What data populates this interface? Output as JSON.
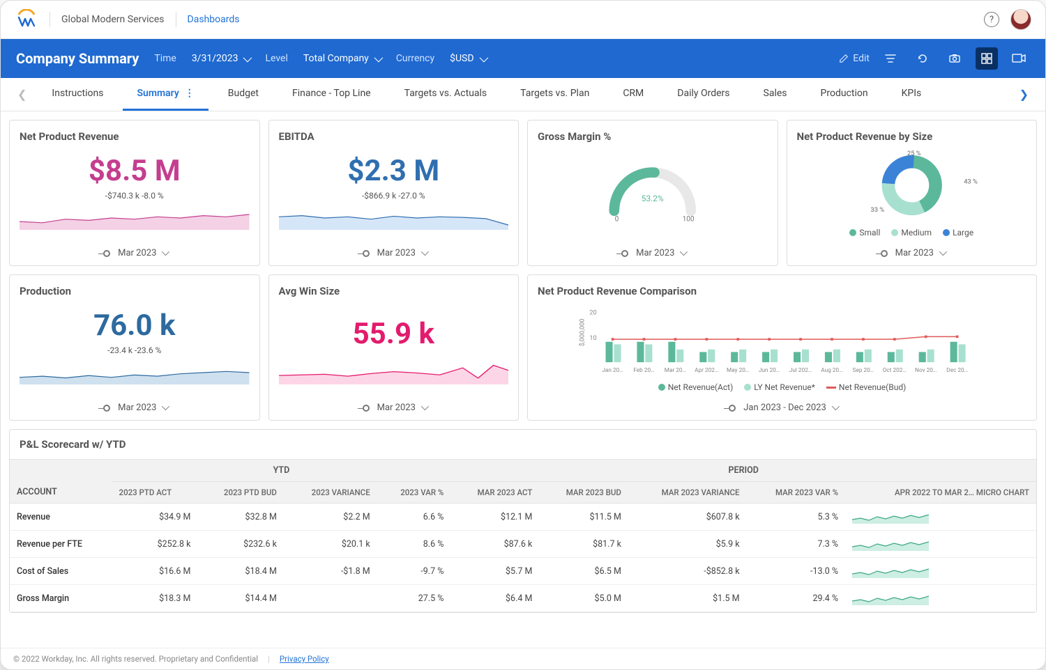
{
  "header": {
    "org": "Global Modern Services",
    "crumb": "Dashboards"
  },
  "bluebar": {
    "title": "Company Summary",
    "filters": [
      {
        "label": "Time",
        "value": "3/31/2023"
      },
      {
        "label": "Level",
        "value": "Total Company"
      },
      {
        "label": "Currency",
        "value": "$USD"
      }
    ],
    "edit": "Edit"
  },
  "tabs": [
    "Instructions",
    "Summary",
    "Budget",
    "Finance - Top Line",
    "Targets vs. Actuals",
    "Targets vs. Plan",
    "CRM",
    "Daily Orders",
    "Sales",
    "Production",
    "KPIs"
  ],
  "active_tab": 1,
  "cards": {
    "net_rev": {
      "title": "Net Product Revenue",
      "value": "$8.5 M",
      "delta": "-$740.3 k   -8.0 %",
      "footer": "Mar 2023"
    },
    "ebitda": {
      "title": "EBITDA",
      "value": "$2.3 M",
      "delta": "-$866.9 k   -27.0 %",
      "footer": "Mar 2023"
    },
    "gross": {
      "title": "Gross Margin %",
      "value": "53.2%",
      "min": "0",
      "max": "100",
      "footer": "Mar 2023"
    },
    "by_size": {
      "title": "Net Product Revenue by Size",
      "footer": "Mar 2023",
      "slices": [
        {
          "label": "Small",
          "pct": 43
        },
        {
          "label": "Medium",
          "pct": 33
        },
        {
          "label": "Large",
          "pct": 25
        }
      ],
      "callouts": [
        "25 %",
        "43 %",
        "33 %"
      ]
    },
    "production": {
      "title": "Production",
      "value": "76.0 k",
      "delta": "-23.4 k   -23.6 %",
      "footer": "Mar 2023"
    },
    "win": {
      "title": "Avg Win Size",
      "value": "55.9 k",
      "footer": "Mar 2023"
    },
    "compare": {
      "title": "Net Product Revenue Comparison",
      "footer": "Jan 2023 - Dec 2023",
      "ylabel": "$,000,000",
      "yticks": [
        "20",
        "10"
      ],
      "xlabels": [
        "Jan 20…",
        "Feb 20…",
        "Mar 20…",
        "Apr 202…",
        "May 20…",
        "Jun 20…",
        "Jul 202…",
        "Aug 20…",
        "Sep 20…",
        "Oct 202…",
        "Nov 20…",
        "Dec 20…"
      ],
      "legend": [
        "Net Revenue(Act)",
        "LY Net Revenue*",
        "Net Revenue(Bud)"
      ]
    }
  },
  "chart_data": [
    {
      "type": "area",
      "title": "Net Product Revenue",
      "series": [
        {
          "name": "rev",
          "values": [
            7.8,
            8.0,
            7.6,
            8.1,
            8.3,
            7.9,
            8.5,
            8.2,
            8.7,
            8.4,
            8.6,
            8.5
          ]
        }
      ]
    },
    {
      "type": "area",
      "title": "EBITDA",
      "series": [
        {
          "name": "ebitda",
          "values": [
            2.6,
            2.7,
            2.5,
            2.6,
            2.4,
            2.7,
            2.5,
            2.6,
            2.55,
            2.6,
            2.45,
            2.0
          ]
        }
      ]
    },
    {
      "type": "gauge",
      "title": "Gross Margin %",
      "value": 53.2,
      "min": 0,
      "max": 100
    },
    {
      "type": "pie",
      "title": "Net Product Revenue by Size",
      "slices": [
        {
          "name": "Small",
          "value": 43
        },
        {
          "name": "Medium",
          "value": 33
        },
        {
          "name": "Large",
          "value": 25
        }
      ]
    },
    {
      "type": "area",
      "title": "Production",
      "series": [
        {
          "name": "prod",
          "values": [
            90,
            92,
            88,
            94,
            89,
            95,
            91,
            86,
            84,
            80,
            78,
            76
          ]
        }
      ]
    },
    {
      "type": "area",
      "title": "Avg Win Size",
      "series": [
        {
          "name": "win",
          "values": [
            48,
            49,
            50,
            47,
            51,
            54,
            53,
            49,
            58,
            45,
            60,
            55.9
          ]
        }
      ]
    },
    {
      "type": "bar",
      "title": "Net Product Revenue Comparison",
      "categories": [
        "Jan",
        "Feb",
        "Mar",
        "Apr",
        "May",
        "Jun",
        "Jul",
        "Aug",
        "Sep",
        "Oct",
        "Nov",
        "Dec"
      ],
      "series": [
        {
          "name": "Net Revenue(Act)",
          "values": [
            8,
            8,
            8,
            4,
            4,
            4,
            4,
            4,
            4,
            4,
            4,
            8
          ]
        },
        {
          "name": "LY Net Revenue*",
          "values": [
            7,
            7,
            5,
            5,
            5,
            5,
            5,
            5,
            5,
            5,
            5,
            7
          ]
        },
        {
          "name": "Net Revenue(Bud)",
          "values": [
            9,
            9,
            9,
            9,
            9,
            9,
            9,
            9,
            9,
            9,
            10,
            10
          ]
        }
      ],
      "ylim": [
        0,
        20
      ],
      "ylabel": "$,000,000"
    }
  ],
  "table": {
    "title": "P&L Scorecard w/ YTD",
    "groups": [
      "ACCOUNT",
      "YTD",
      "PERIOD"
    ],
    "columns": [
      "ACCOUNT",
      "2023 PTD ACT",
      "2023 PTD BUD",
      "2023 VARIANCE",
      "2023 VAR %",
      "MAR 2023 ACT",
      "MAR 2023 BUD",
      "MAR 2023 VARIANCE",
      "MAR 2023 VAR %",
      "APR 2022 TO MAR 2… MICRO CHART"
    ],
    "rows": [
      {
        "acct": "Revenue",
        "c": [
          "$34.9 M",
          "$32.8 M",
          "$2.2 M",
          "6.6 %",
          "$12.1 M",
          "$11.5 M",
          "$607.8 k",
          "5.3 %"
        ]
      },
      {
        "acct": "Revenue per FTE",
        "c": [
          "$252.8 k",
          "$232.6 k",
          "$20.1 k",
          "8.6 %",
          "$87.6 k",
          "$81.7 k",
          "$5.9 k",
          "7.3 %"
        ]
      },
      {
        "acct": "Cost of Sales",
        "c": [
          "$16.6 M",
          "$18.4 M",
          "-$1.8 M",
          "-9.7 %",
          "$5.7 M",
          "$6.5 M",
          "-$852.8 k",
          "-13.0 %"
        ]
      },
      {
        "acct": "Gross Margin",
        "c": [
          "$18.3 M",
          "$14.4 M",
          "",
          "27.5 %",
          "$6.4 M",
          "$5.0 M",
          "$1.5 M",
          "29.4 %"
        ]
      }
    ]
  },
  "footer": {
    "copy": "© 2022 Workday, Inc. All rights reserved. Proprietary and Confidential",
    "link": "Privacy Policy"
  },
  "colors": {
    "small": "#5cb89b",
    "medium": "#a8e0cf",
    "large": "#3b83d6",
    "act": "#5cb89b",
    "ly": "#a8e0cf",
    "bud": "#e05a5a"
  }
}
